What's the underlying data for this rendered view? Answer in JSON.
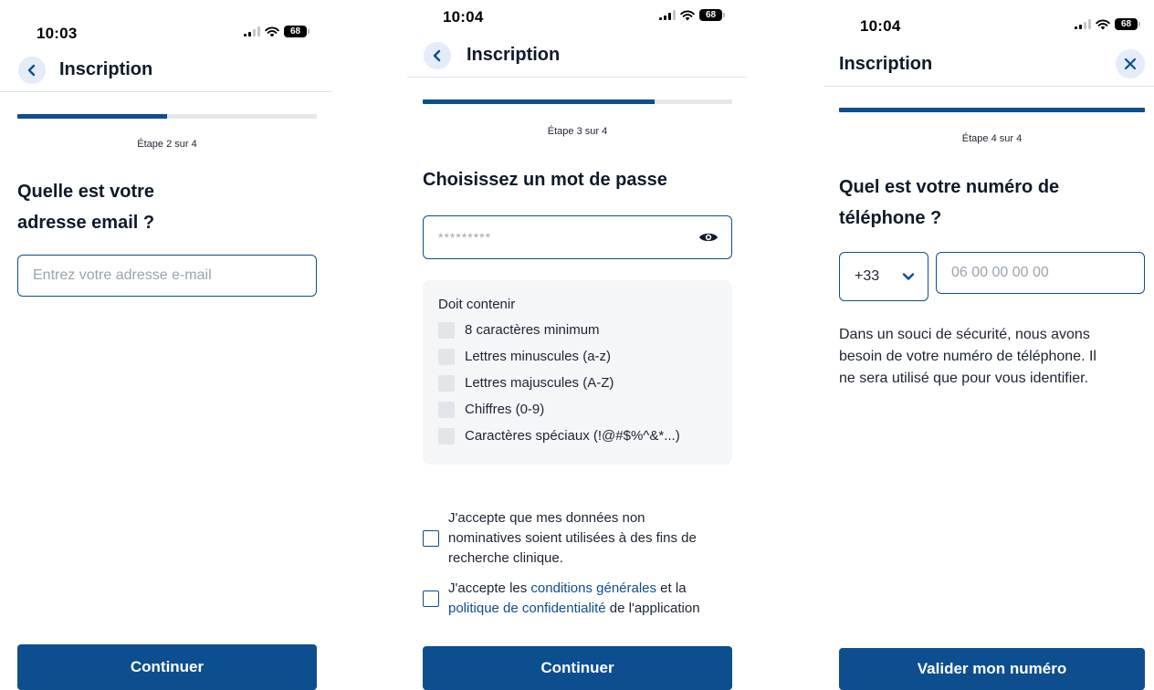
{
  "screen_step2": {
    "status_time": "10:03",
    "battery": "68",
    "header_title": "Inscription",
    "progress": 0.5,
    "step_label": "Étape 2 sur 4",
    "question_line1": "Quelle est votre",
    "question_line2": "adresse email ?",
    "email_placeholder": "Entrez votre adresse e-mail",
    "continue_label": "Continuer"
  },
  "screen_step3": {
    "status_time": "10:04",
    "battery": "68",
    "header_title": "Inscription",
    "progress": 0.75,
    "step_label": "Étape 3 sur 4",
    "question": "Choisissez un mot de passe",
    "password_masked": "*********",
    "rules_title": "Doit contenir",
    "rules": [
      "8 caractères minimum",
      "Lettres minuscules (a-z)",
      "Lettres majuscules (A-Z)",
      "Chiffres (0-9)",
      "Caractères spéciaux (!@#$%^&*...)"
    ],
    "consent_research_line1": "J'accepte que mes données non",
    "consent_research_line2": "nominatives soient utilisées à des fins de",
    "consent_research_line3": "recherche clinique.",
    "consent_terms_prefix": "J'accepte les ",
    "consent_terms_link": "conditions générales",
    "consent_terms_mid": " et la",
    "consent_privacy_link": "politique de confidentialité",
    "consent_privacy_suffix": " de l'application",
    "continue_label": "Continuer"
  },
  "screen_step4": {
    "status_time": "10:04",
    "battery": "68",
    "header_title": "Inscription",
    "progress": 1.0,
    "step_label": "Étape 4 sur 4",
    "question_line1": "Quel est votre numéro de",
    "question_line2": "téléphone ?",
    "country_code": "+33",
    "phone_placeholder": "06 00 00 00 00",
    "info_line1": "Dans un souci de sécurité, nous avons",
    "info_line2": "besoin de votre numéro de téléphone. Il",
    "info_line3": "ne sera utilisé que pour vous identifier.",
    "validate_label": "Valider mon numéro"
  },
  "colors": {
    "primary": "#0d4e8f",
    "icon_bg": "#e3ecf8",
    "progress_track": "#e4e7eb",
    "rules_bg": "#f4f6f8"
  },
  "icons": {
    "back": "chevron-left-icon",
    "close": "close-icon",
    "password_toggle": "eye-icon",
    "country_dropdown": "chevron-down-icon"
  }
}
